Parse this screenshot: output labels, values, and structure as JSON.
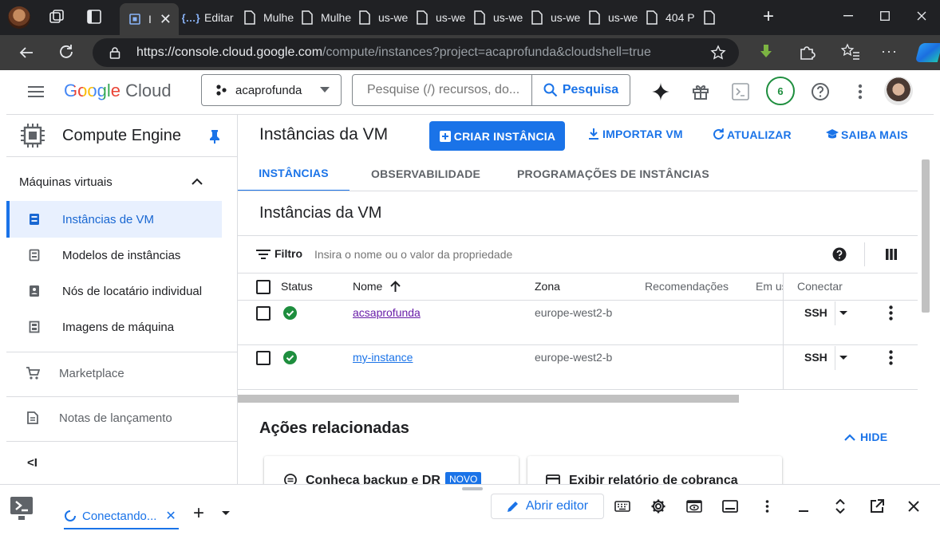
{
  "browser": {
    "tabs": [
      {
        "icon": "compute-engine-icon",
        "label": "I",
        "active": true
      },
      {
        "icon": "brackets-icon",
        "label": "Editar"
      },
      {
        "icon": "document-icon",
        "label": "Mulhe"
      },
      {
        "icon": "document-icon",
        "label": "Mulhe"
      },
      {
        "icon": "document-icon",
        "label": "us-we"
      },
      {
        "icon": "document-icon",
        "label": "us-we"
      },
      {
        "icon": "document-icon",
        "label": "us-we"
      },
      {
        "icon": "document-icon",
        "label": "us-we"
      },
      {
        "icon": "document-icon",
        "label": "us-we"
      },
      {
        "icon": "document-icon",
        "label": "404 P"
      }
    ],
    "url_host": "https://console.cloud.google.com",
    "url_path": "/compute/instances?project=acaprofunda&cloudshell=true"
  },
  "header": {
    "logo_google": "Google",
    "logo_cloud": "Cloud",
    "project": "acaprofunda",
    "search_placeholder": "Pesquise (/) recursos, do...",
    "search_button": "Pesquisa",
    "notifications_count": "6"
  },
  "sidebar": {
    "product": "Compute Engine",
    "section": "Máquinas virtuais",
    "items": [
      {
        "label": "Instâncias de VM",
        "active": true
      },
      {
        "label": "Modelos de instâncias"
      },
      {
        "label": "Nós de locatário individual"
      },
      {
        "label": "Imagens de máquina"
      }
    ],
    "marketplace": "Marketplace",
    "release_notes": "Notas de lançamento",
    "collapse": "<I"
  },
  "main": {
    "page_title": "Instâncias da VM",
    "create_button": "CRIAR INSTÂNCIA",
    "import_button": "IMPORTAR VM",
    "refresh_button": "ATUALIZAR",
    "learn_button": "SAIBA MAIS",
    "tabs": [
      "INSTÂNCIAS",
      "OBSERVABILIDADE",
      "PROGRAMAÇÕES DE INSTÂNCIAS"
    ],
    "section_title": "Instâncias da VM",
    "filter_label": "Filtro",
    "filter_placeholder": "Insira o nome ou o valor da propriedade",
    "columns": {
      "status": "Status",
      "name": "Nome",
      "zone": "Zona",
      "recommendations": "Recomendações",
      "in_use": "Em us",
      "connect": "Conectar"
    },
    "rows": [
      {
        "name": "acsaprofunda",
        "zone": "europe-west2-b",
        "connect": "SSH"
      },
      {
        "name": "my-instance",
        "zone": "europe-west2-b",
        "connect": "SSH"
      }
    ],
    "related_title": "Ações relacionadas",
    "hide_button": "HIDE",
    "card1": "Conheça backup e DR",
    "card1_badge": "NOVO",
    "card2": "Exibir relatório de cobrança"
  },
  "cloudshell": {
    "tab_label": "Conectando...",
    "open_editor": "Abrir editor"
  },
  "colors": {
    "accent": "#1a73e8",
    "success": "#1e8e3e",
    "active_nav_bg": "#e8f0fe",
    "link_visited": "#681da8"
  }
}
